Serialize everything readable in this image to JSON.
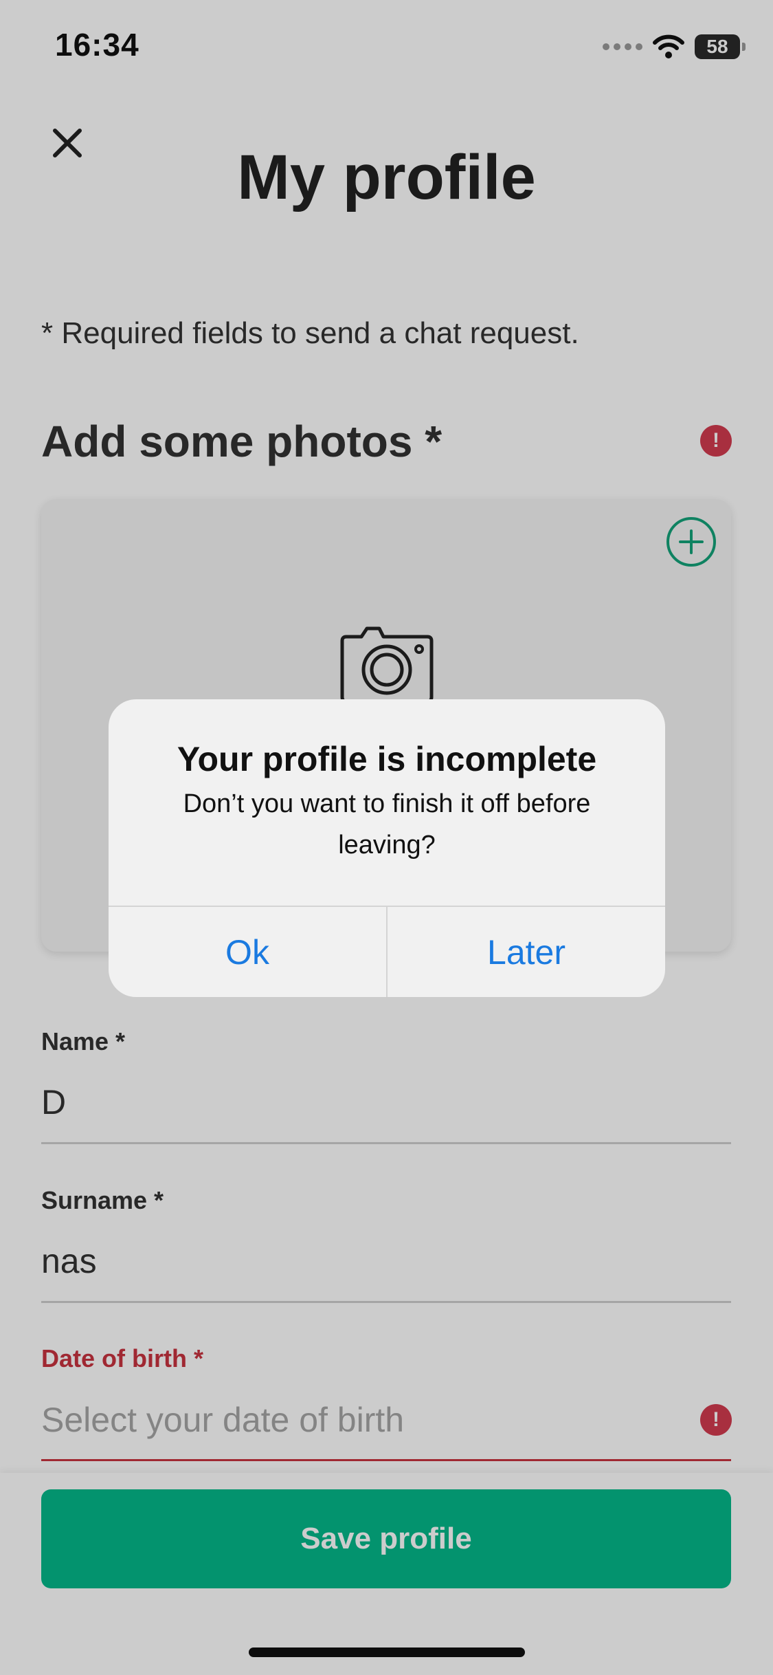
{
  "status_bar": {
    "time": "16:34",
    "battery": "58"
  },
  "header": {
    "title": "My profile"
  },
  "required_note": "* Required fields to send a chat request.",
  "photos": {
    "title": "Add some photos *"
  },
  "fields": {
    "name": {
      "label": "Name *",
      "value": "D"
    },
    "surname": {
      "label": "Surname *",
      "value": "nas"
    },
    "dob": {
      "label": "Date of birth *",
      "placeholder": "Select your date of birth"
    }
  },
  "save_button": "Save profile",
  "alert": {
    "title": "Your profile is incomplete",
    "message": "Don’t you want to finish it off before leaving?",
    "ok": "Ok",
    "later": "Later"
  },
  "colors": {
    "accent": "#04b88a",
    "error": "#c8323f",
    "link": "#1a7ae0"
  },
  "icons": [
    "close-icon",
    "error-icon",
    "plus-icon",
    "camera-icon",
    "wifi-icon"
  ]
}
